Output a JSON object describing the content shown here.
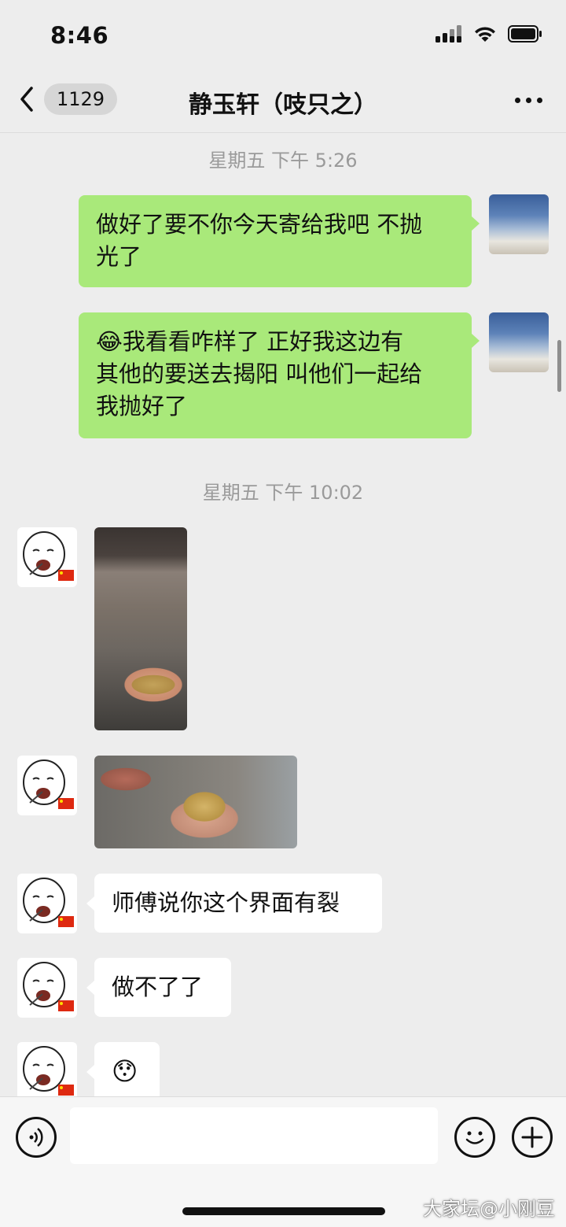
{
  "status_bar": {
    "time": "8:46"
  },
  "nav": {
    "back_count": "1129",
    "title": "静玉轩（吱只之）"
  },
  "messages": {
    "timestamp_1": "星期五 下午 5:26",
    "me_1_line1": "做好了要不你今天寄给我吧 不抛",
    "me_1_line2": "光了",
    "me_2_emoji": "😂",
    "me_2_line1": "我看看咋样了 正好我这边有",
    "me_2_line2": "其他的要送去揭阳 叫他们一起给",
    "me_2_line3": "我抛好了",
    "timestamp_2": "星期五 下午 10:02",
    "other_text_1": "师傅说你这个界面有裂",
    "other_text_2": "做不了了",
    "other_sticker": "😯"
  },
  "input_bar": {
    "placeholder": ""
  },
  "watermark": "大家坛@小刚豆",
  "colors": {
    "background": "#ededed",
    "my_bubble": "#a9e97a",
    "other_bubble": "#ffffff",
    "timestamp": "#9a9a9a"
  },
  "icons": [
    "signal-icon",
    "wifi-icon",
    "battery-icon",
    "back-chevron-icon",
    "more-icon",
    "voice-icon",
    "emoji-icon",
    "plus-icon"
  ]
}
